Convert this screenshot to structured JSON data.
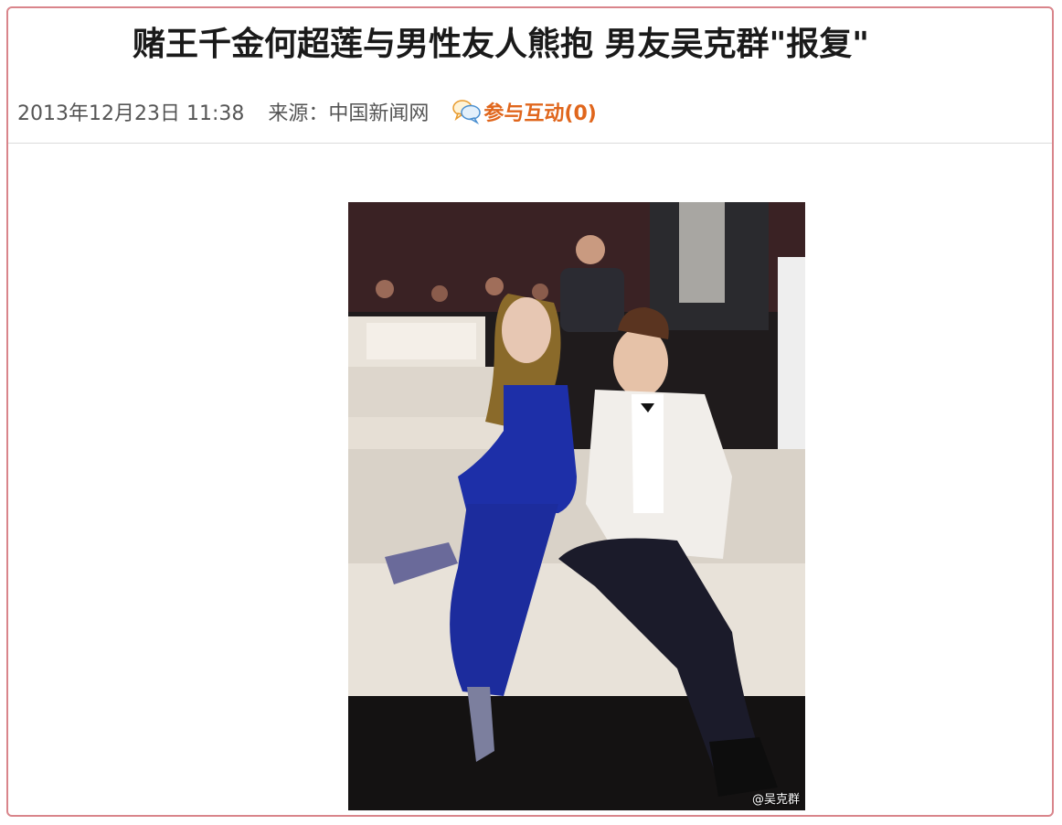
{
  "article": {
    "title": "赌王千金何超莲与男性友人熊抱 男友吴克群\"报复\"",
    "date": "2013年12月23日 11:38",
    "source_label": "来源：",
    "source_name": "中国新闻网",
    "interact_label": "参与互动(0)",
    "interact_icon": "speech-bubble-icon"
  },
  "photo": {
    "watermark": "@吴克群"
  },
  "colors": {
    "border": "#d9858b",
    "interact": "#e0661c",
    "text": "#1a1a1a",
    "meta": "#555555"
  }
}
